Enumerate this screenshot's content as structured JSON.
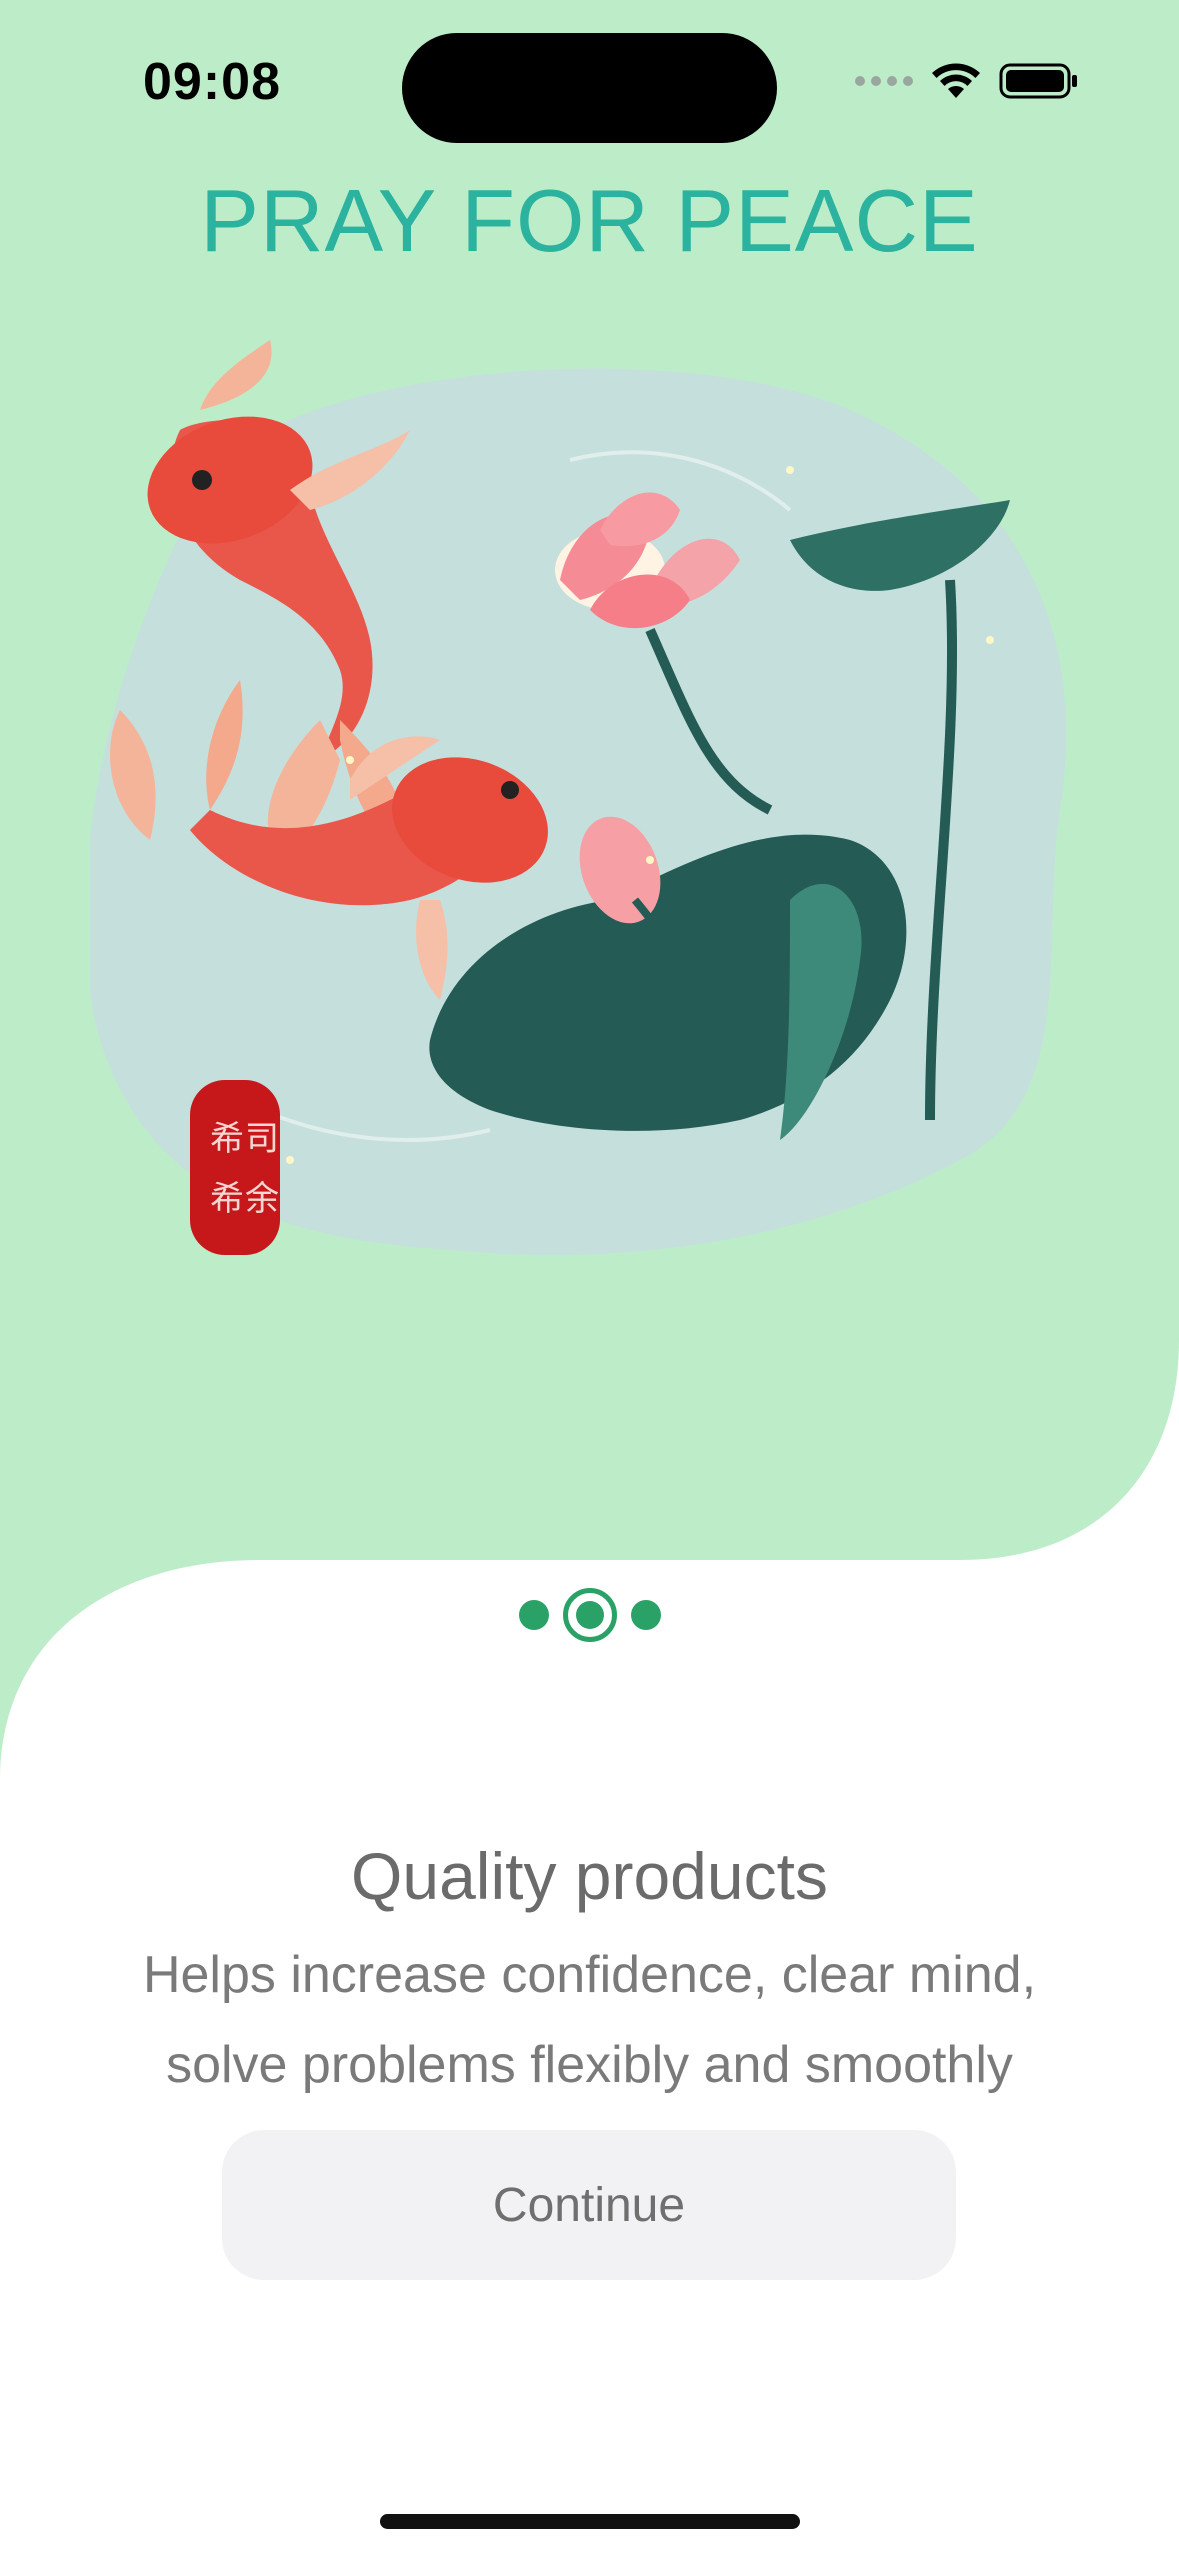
{
  "status_bar": {
    "time": "09:08",
    "icons": [
      "signal-dots-icon",
      "wifi-icon",
      "battery-icon"
    ]
  },
  "header": {
    "title": "PRAY FOR PEACE"
  },
  "illustration": {
    "name": "koi-fish-and-lotus-illustration",
    "icons": [
      "koi-fish-icon",
      "lotus-flower-icon",
      "lotus-leaf-icon",
      "red-seal-stamp-icon"
    ]
  },
  "pager": {
    "count": 3,
    "active_index": 1
  },
  "content": {
    "headline": "Quality products",
    "description": "Helps increase confidence, clear mind, solve problems flexibly and smoothly"
  },
  "actions": {
    "continue_label": "Continue"
  },
  "colors": {
    "background_green": "#bdedc8",
    "title": "#2bb3a0",
    "accent_green": "#2aa267",
    "button_bg": "#f2f2f4",
    "text_gray": "#6b6b6b"
  }
}
